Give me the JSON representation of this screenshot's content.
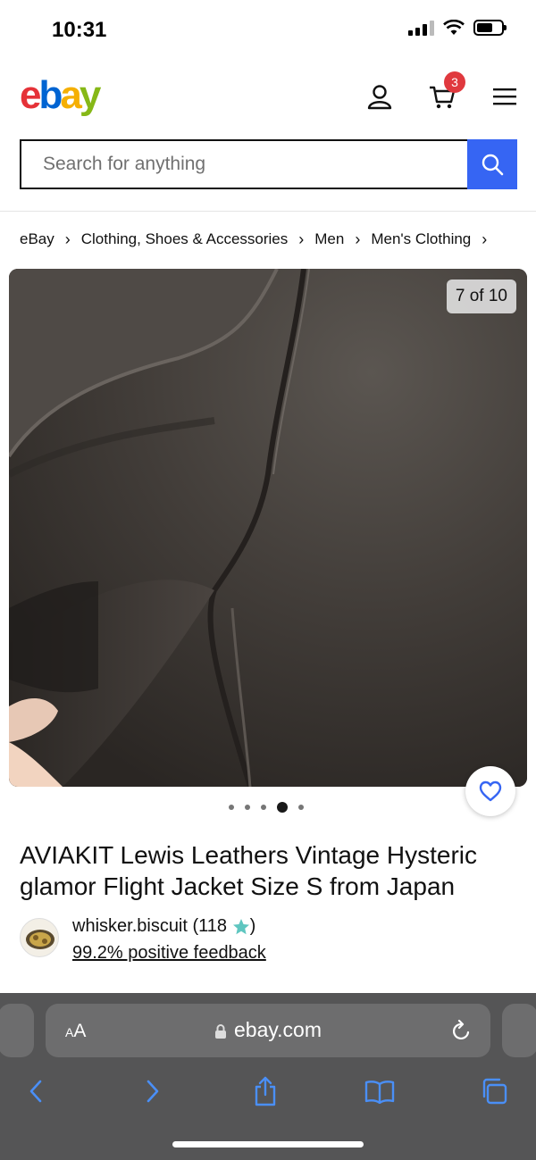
{
  "status_bar": {
    "time": "10:31"
  },
  "header": {
    "logo": {
      "e": "e",
      "b": "b",
      "a": "a",
      "y": "y"
    },
    "cart_count": "3"
  },
  "search": {
    "placeholder": "Search for anything"
  },
  "breadcrumb": [
    "eBay",
    "Clothing, Shoes & Accessories",
    "Men",
    "Men's Clothing"
  ],
  "gallery": {
    "counter": "7 of 10",
    "dots_total": 5,
    "dots_active_index": 3
  },
  "listing": {
    "title": "AVIAKIT Lewis Leathers Vintage Hysteric glamor Flight Jacket Size S from Japan"
  },
  "seller": {
    "name": "whisker.biscuit",
    "score_open": " (118 ",
    "score_close": ")",
    "feedback": "99.2% positive feedback"
  },
  "browser": {
    "aa_small": "A",
    "aa_large": "A",
    "url": "ebay.com"
  },
  "colors": {
    "search_button": "#3665f3",
    "badge": "#e0393e",
    "safari_bar": "#555556",
    "safari_icons": "#4a8ff7",
    "star": "#5fc6c0"
  }
}
